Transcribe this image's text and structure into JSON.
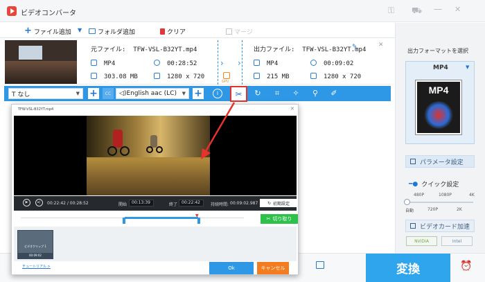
{
  "app": {
    "title": "ビデオコンバータ"
  },
  "toolbar": {
    "add_file": "ファイル追加",
    "add_folder": "フォルダ追加",
    "clear": "クリア",
    "merge": "マージ"
  },
  "file": {
    "source_label": "元ファイル:",
    "source_name": "TFW-VSL-B32YT.mp4",
    "src_format": "MP4",
    "src_duration": "00:28:52",
    "src_size": "303.08 MB",
    "src_resolution": "1280 x 720",
    "output_label": "出力ファイル:",
    "output_name": "TFW-VSL-B32YT.mp4",
    "out_format": "MP4",
    "out_duration": "00:09:02",
    "out_size": "215 MB",
    "out_resolution": "1280 x 720",
    "gpu_label": "GPU"
  },
  "editbar": {
    "subtitle_select": "なし",
    "audio_select": "English aac (LC)"
  },
  "right_panel": {
    "format_title": "出力フォーマットを選択",
    "format_value": "MP4",
    "format_badge": "MP4",
    "param_button": "パラメータ設定",
    "quick_label": "クイック設定",
    "ticks_top": [
      "480P",
      "1080P",
      "4K"
    ],
    "ticks_bottom": [
      "自動",
      "720P",
      "2K"
    ],
    "gpu_accel": "ビデオカード加速",
    "nvidia": "NVIDIA",
    "intel": "Intel"
  },
  "bottom": {
    "convert_label": "変換"
  },
  "dialog": {
    "title": "TFW-VSL-B32YT.mp4",
    "time_current": "00:22:42 / 00:28:52",
    "start_label": "開始",
    "start_value": "00:13:39",
    "end_label": "終了",
    "end_value": "00:22:42",
    "duration_label": "持続時間:",
    "duration_value": "00:09:02.987",
    "reset_label": "初期設定",
    "cut_label": "切り取り",
    "clip_label": "ビデオクリップ 1",
    "clip_time": "00:09:02",
    "tutorial_link": "チュートリアル >",
    "ok_label": "Ok",
    "cancel_label": "キャンセル"
  },
  "colors": {
    "accent": "#2e98e6",
    "highlight": "#e8302c",
    "green": "#2ec14a",
    "orange": "#f57b1f"
  },
  "quick_level": 0
}
